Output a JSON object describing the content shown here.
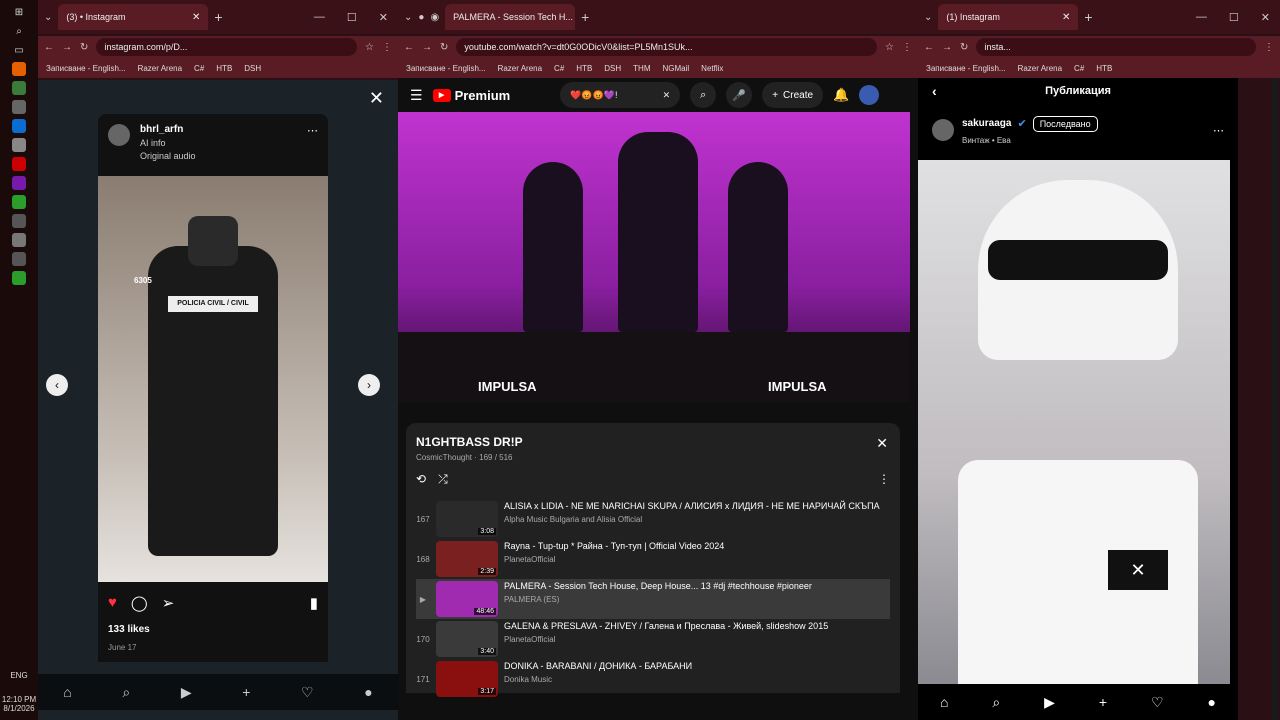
{
  "taskbar": {
    "lang": "ENG",
    "time": "12:10 PM",
    "date": "8/1/2026"
  },
  "win1": {
    "tab": "(3) • Instagram",
    "url": "instagram.com/p/D...",
    "bookmarks": [
      "Записване - English...",
      "Razer Arena",
      "C#",
      "HTB",
      "DSH"
    ],
    "post": {
      "user": "bhrl_arfn",
      "info": "AI info",
      "audio": "Original audio",
      "likes": "133 likes",
      "date": "June 17",
      "badge": "POLICIA CIVIL / CIVIL",
      "num": "6305"
    }
  },
  "win2": {
    "tab": "PALMERA - Session Tech H...",
    "url": "youtube.com/watch?v=dt0G0ODicV0&list=PL5Mn1SUk...",
    "bookmarks": [
      "Записване - English...",
      "Razer Arena",
      "C#",
      "HTB",
      "DSH",
      "THM",
      "NGMail",
      "Netflix"
    ],
    "brand": "Premium",
    "search": "❤️😡😡💜!",
    "create": "Create",
    "video_logo": "IMPULSA",
    "playlist": {
      "title": "N1GHTBASS DR!P",
      "sub": "CosmicThought · 169 / 516",
      "items": [
        {
          "idx": "167",
          "title": "ALISIA x LIDIA - NE ME NARICHAI SKUPA / АЛИСИЯ x ЛИДИЯ - НЕ МЕ НАРИЧАЙ СКЪПА",
          "channel": "Alpha Music Bulgaria and Alisia Official",
          "dur": "3:08",
          "color": "#2a2a2a"
        },
        {
          "idx": "168",
          "title": "Rayna - Tup-tup * Райна - Туп-туп | Official Video 2024",
          "channel": "PlanetaOfficial",
          "dur": "2:39",
          "color": "#7a2020"
        },
        {
          "idx": "▶",
          "title": "PALMERA - Session Tech House, Deep House... 13 #dj #techhouse #pioneer",
          "channel": "PALMERA (ES)",
          "dur": "48:46",
          "color": "#a02ab0"
        },
        {
          "idx": "170",
          "title": "GALENA & PRESLAVA - ZHIVEY / Галена и Преслава - Живей, slideshow 2015",
          "channel": "PlanetaOfficial",
          "dur": "3:40",
          "color": "#3a3a3a"
        },
        {
          "idx": "171",
          "title": "DONIKA - BARABANI / ДОНИКА - БАРАБАНИ",
          "channel": "Donika Music",
          "dur": "3:17",
          "color": "#8a1010"
        }
      ]
    }
  },
  "win3": {
    "tab": "(1) Instagram",
    "url": "insta...",
    "bookmarks": [
      "Записване - English...",
      "Razer Arena",
      "C#",
      "HTB"
    ],
    "page_title": "Публикация",
    "user": "sakuraaga",
    "follow": "Последвано",
    "sub": "Винтаж • Ева"
  }
}
